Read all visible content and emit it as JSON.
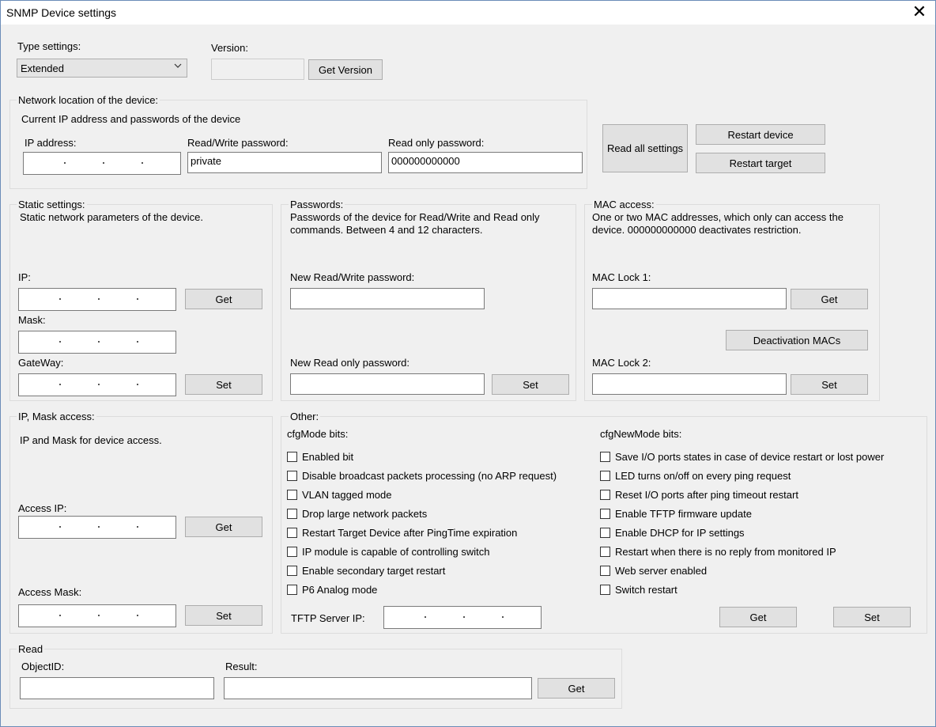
{
  "window": {
    "title": "SNMP Device settings"
  },
  "type_settings": {
    "label": "Type settings:",
    "value": "Extended"
  },
  "version": {
    "label": "Version:",
    "value": "",
    "button": "Get Version"
  },
  "network": {
    "title": "Network location of the device:",
    "description": "Current IP address and passwords of the device",
    "ip_label": "IP address:",
    "rw_label": "Read/Write password:",
    "rw_value": "private",
    "ro_label": "Read only password:",
    "ro_value": "000000000000"
  },
  "actions": {
    "read_all": "Read all settings",
    "restart_device": "Restart device",
    "restart_target": "Restart target"
  },
  "static": {
    "title": "Static settings:",
    "description": "Static network parameters of the device.",
    "ip_label": "IP:",
    "mask_label": "Mask:",
    "gateway_label": "GateWay:",
    "get": "Get",
    "set": "Set"
  },
  "passwords": {
    "title": "Passwords:",
    "description_1": "Passwords of the device for Read/Write and Read only",
    "description_2": "commands. Between 4 and 12 characters.",
    "new_rw_label": "New Read/Write password:",
    "new_ro_label": "New Read only password:",
    "set": "Set"
  },
  "mac": {
    "title": "MAC access:",
    "description_1": "One or two MAC addresses, which only can access the",
    "description_2": "device. 000000000000 deactivates restriction.",
    "lock1_label": "MAC Lock 1:",
    "lock2_label": "MAC Lock 2:",
    "get": "Get",
    "deactivation": "Deactivation MACs",
    "set": "Set"
  },
  "ipmask": {
    "title": "IP, Mask access:",
    "description": "IP and Mask for device access.",
    "access_ip_label": "Access IP:",
    "access_mask_label": "Access Mask:",
    "get": "Get",
    "set": "Set"
  },
  "other": {
    "title": "Other:",
    "cfgmode_label": "cfgMode bits:",
    "cfgnewmode_label": "cfgNewMode bits:",
    "cfgmode_bits": [
      "Enabled bit",
      "Disable broadcast packets processing (no ARP request)",
      "VLAN tagged mode",
      "Drop large network packets",
      "Restart Target Device after PingTime expiration",
      "IP module is capable of controlling switch",
      "Enable secondary target restart",
      "P6 Analog mode"
    ],
    "cfgnewmode_bits": [
      "Save I/O ports states in case of device restart or lost power",
      "LED turns on/off on every ping request",
      "Reset I/O ports after ping timeout restart",
      "Enable TFTP firmware update",
      "Enable DHCP for IP settings",
      "Restart when there is no reply from monitored IP",
      "Web server enabled",
      "Switch restart"
    ],
    "tftp_label": "TFTP Server IP:",
    "get": "Get",
    "set": "Set"
  },
  "read": {
    "title": "Read",
    "objectid_label": "ObjectID:",
    "result_label": "Result:",
    "get": "Get"
  }
}
